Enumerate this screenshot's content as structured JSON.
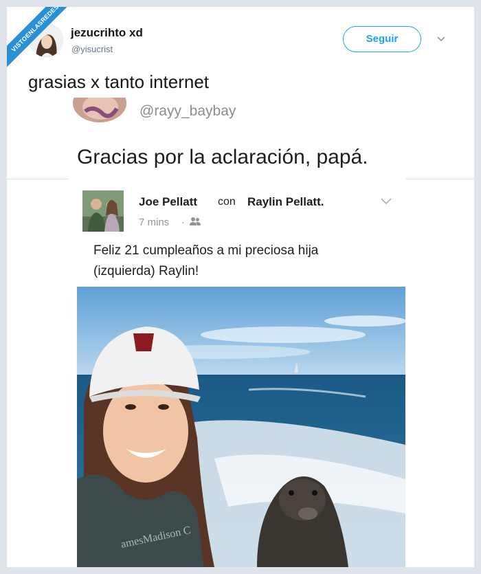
{
  "watermark": "VISTOENLASREDES",
  "tweet": {
    "user_name": "jezucrihto xd",
    "user_handle": "@yisucrist",
    "follow_label": "Seguir",
    "text": "grasias x tanto internet"
  },
  "quoted": {
    "handle": "@rayy_baybay",
    "text": "Gracias por la aclaración, papá."
  },
  "facebook_post": {
    "author": "Joe Pellatt",
    "con": "con",
    "coauthor": "Raylin Pellatt.",
    "time": "7 mins",
    "separator": "·",
    "text_line1": "Feliz 21 cumpleaños a mi preciosa hija",
    "text_line2": "(izquierda) Raylin!",
    "photo_shirt_text": "amesMadison C"
  },
  "colors": {
    "accent": "#1da1f2",
    "ribbon": "#2a8fd6",
    "sea": "#1f5e86",
    "sky": "#8cc0e6"
  },
  "icons": [
    "chevron-down-icon",
    "friends-icon"
  ]
}
